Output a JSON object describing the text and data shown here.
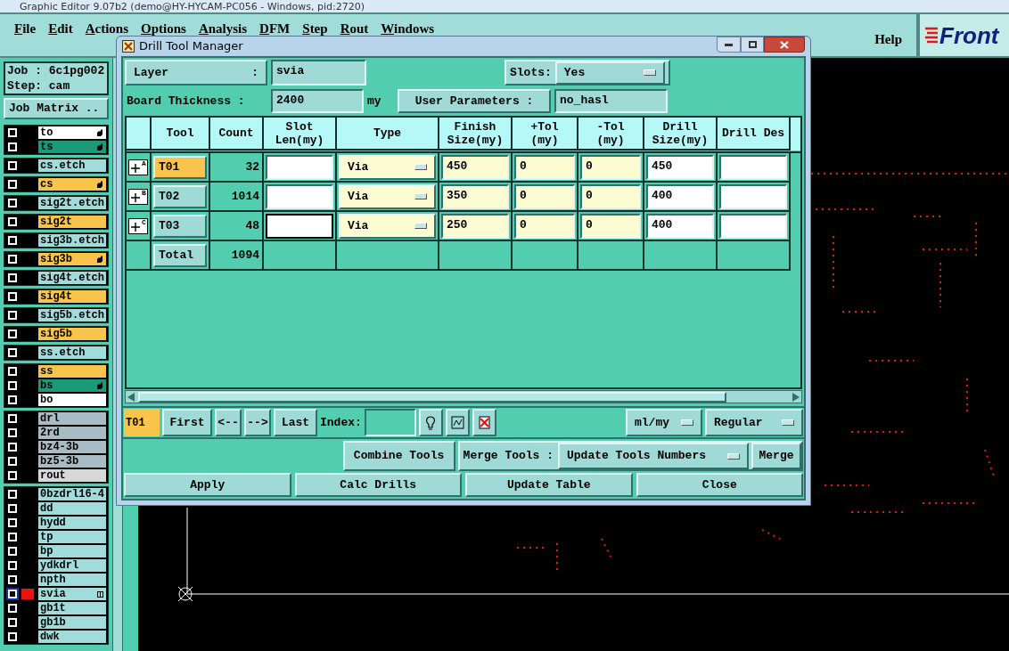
{
  "app": {
    "title": "Graphic Editor 9.07b2 (demo@HY-HYCAM-PC056 - Windows, pid:2720)",
    "menu": [
      "File",
      "Edit",
      "Actions",
      "Options",
      "Analysis",
      "DFM",
      "Step",
      "Rout",
      "Windows"
    ],
    "help": "Help",
    "logo": "Front"
  },
  "job": {
    "job": "Job : 6c1pg002",
    "step": "Step: cam",
    "matrix_button": "Job Matrix .."
  },
  "layer_groups": [
    {
      "layers": [
        {
          "name": "to",
          "color": "#ffffff",
          "hand": true,
          "selected": false
        },
        {
          "name": "ts",
          "color": "#1a9a78",
          "hand": true,
          "selected": false
        }
      ]
    },
    {
      "layers": [
        {
          "name": "cs.etch",
          "color": "#a0dcdc",
          "hand": false,
          "selected": false
        }
      ]
    },
    {
      "layers": [
        {
          "name": "cs",
          "color": "#f8c44c",
          "hand": true,
          "selected": false
        }
      ]
    },
    {
      "layers": [
        {
          "name": "sig2t.etch",
          "color": "#a0dcdc",
          "hand": false,
          "selected": false
        }
      ]
    },
    {
      "layers": [
        {
          "name": "sig2t",
          "color": "#f8c44c",
          "hand": false,
          "selected": false
        }
      ]
    },
    {
      "layers": [
        {
          "name": "sig3b.etch",
          "color": "#a0dcdc",
          "hand": false,
          "selected": false
        }
      ]
    },
    {
      "layers": [
        {
          "name": "sig3b",
          "color": "#f8c44c",
          "hand": true,
          "selected": false
        }
      ]
    },
    {
      "layers": [
        {
          "name": "sig4t.etch",
          "color": "#a0dcdc",
          "hand": false,
          "selected": false
        }
      ]
    },
    {
      "layers": [
        {
          "name": "sig4t",
          "color": "#f8c44c",
          "hand": false,
          "selected": false
        }
      ]
    },
    {
      "layers": [
        {
          "name": "sig5b.etch",
          "color": "#a0dcdc",
          "hand": false,
          "selected": false
        }
      ]
    },
    {
      "layers": [
        {
          "name": "sig5b",
          "color": "#f8c44c",
          "hand": false,
          "selected": false
        }
      ]
    },
    {
      "layers": [
        {
          "name": "ss.etch",
          "color": "#a0dcdc",
          "hand": false,
          "selected": false
        }
      ]
    },
    {
      "layers": [
        {
          "name": "ss",
          "color": "#f8c44c",
          "hand": false,
          "selected": false
        },
        {
          "name": "bs",
          "color": "#1a9a78",
          "hand": true,
          "selected": false
        },
        {
          "name": "bo",
          "color": "#ffffff",
          "hand": false,
          "selected": false
        }
      ]
    },
    {
      "layers": [
        {
          "name": "drl",
          "color": "#a8bcc4",
          "hand": false,
          "selected": false
        },
        {
          "name": "2rd",
          "color": "#a8bcc4",
          "hand": false,
          "selected": false
        },
        {
          "name": "bz4-3b",
          "color": "#a8bcc4",
          "hand": false,
          "selected": false
        },
        {
          "name": "bz5-3b",
          "color": "#a8bcc4",
          "hand": false,
          "selected": false
        },
        {
          "name": "rout",
          "color": "#d8d8d8",
          "hand": false,
          "selected": false
        }
      ]
    },
    {
      "layers": [
        {
          "name": "0bzdrl16-4",
          "color": "#a0dcdc",
          "hand": false,
          "selected": false
        },
        {
          "name": "dd",
          "color": "#a0dcdc",
          "hand": false,
          "selected": false
        },
        {
          "name": "hydd",
          "color": "#a0dcdc",
          "hand": false,
          "selected": false
        },
        {
          "name": "tp",
          "color": "#a0dcdc",
          "hand": false,
          "selected": false
        },
        {
          "name": "bp",
          "color": "#a0dcdc",
          "hand": false,
          "selected": false
        },
        {
          "name": "ydkdrl",
          "color": "#a0dcdc",
          "hand": false,
          "selected": false
        },
        {
          "name": "npth",
          "color": "#a0dcdc",
          "hand": false,
          "selected": false
        },
        {
          "name": "svia",
          "color": "#a0dcdc",
          "hand": false,
          "selected": true
        },
        {
          "name": "gb1t",
          "color": "#a0dcdc",
          "hand": false,
          "selected": false
        },
        {
          "name": "gb1b",
          "color": "#a0dcdc",
          "hand": false,
          "selected": false
        },
        {
          "name": "dwk",
          "color": "#a0dcdc",
          "hand": false,
          "selected": false
        }
      ]
    }
  ],
  "dialog": {
    "title": "Drill Tool Manager",
    "layer": {
      "label": "Layer",
      "colon": ":",
      "value": "svia"
    },
    "slots": {
      "label": "Slots:",
      "value": "Yes"
    },
    "thickness": {
      "label": "Board Thickness :",
      "value": "2400",
      "unit": "my"
    },
    "user_params": {
      "label": "User Parameters :",
      "value": "no_hasl"
    },
    "table": {
      "columns": [
        "Tool",
        "Count",
        "Slot Len(my)",
        "Type",
        "Finish Size(my)",
        "+Tol (my)",
        "-Tol (my)",
        "Drill Size(my)",
        "Drill Des"
      ],
      "rows": [
        {
          "mark": "A",
          "tool": "T01",
          "selected": true,
          "count": "32",
          "slot_focused": false,
          "type": "Via",
          "finish": "450",
          "plus_tol": "0",
          "minus_tol": "0",
          "drill_size": "450"
        },
        {
          "mark": "B",
          "tool": "T02",
          "selected": false,
          "count": "1014",
          "slot_focused": false,
          "type": "Via",
          "finish": "350",
          "plus_tol": "0",
          "minus_tol": "0",
          "drill_size": "400"
        },
        {
          "mark": "C",
          "tool": "T03",
          "selected": false,
          "count": "48",
          "slot_focused": true,
          "type": "Via",
          "finish": "250",
          "plus_tol": "0",
          "minus_tol": "0",
          "drill_size": "400"
        }
      ],
      "total": {
        "label": "Total",
        "count": "1094"
      }
    },
    "nav": {
      "current": "T01",
      "buttons": [
        "First",
        "<--",
        "-->",
        "Last"
      ],
      "index_label": "Index:",
      "units": "ml/my",
      "mode": "Regular"
    },
    "merge": {
      "combine": "Combine Tools",
      "label": "Merge Tools :",
      "mode": "Update Tools Numbers",
      "button": "Merge"
    },
    "actions": [
      "Apply",
      "Calc Drills",
      "Update Table",
      "Close"
    ]
  }
}
